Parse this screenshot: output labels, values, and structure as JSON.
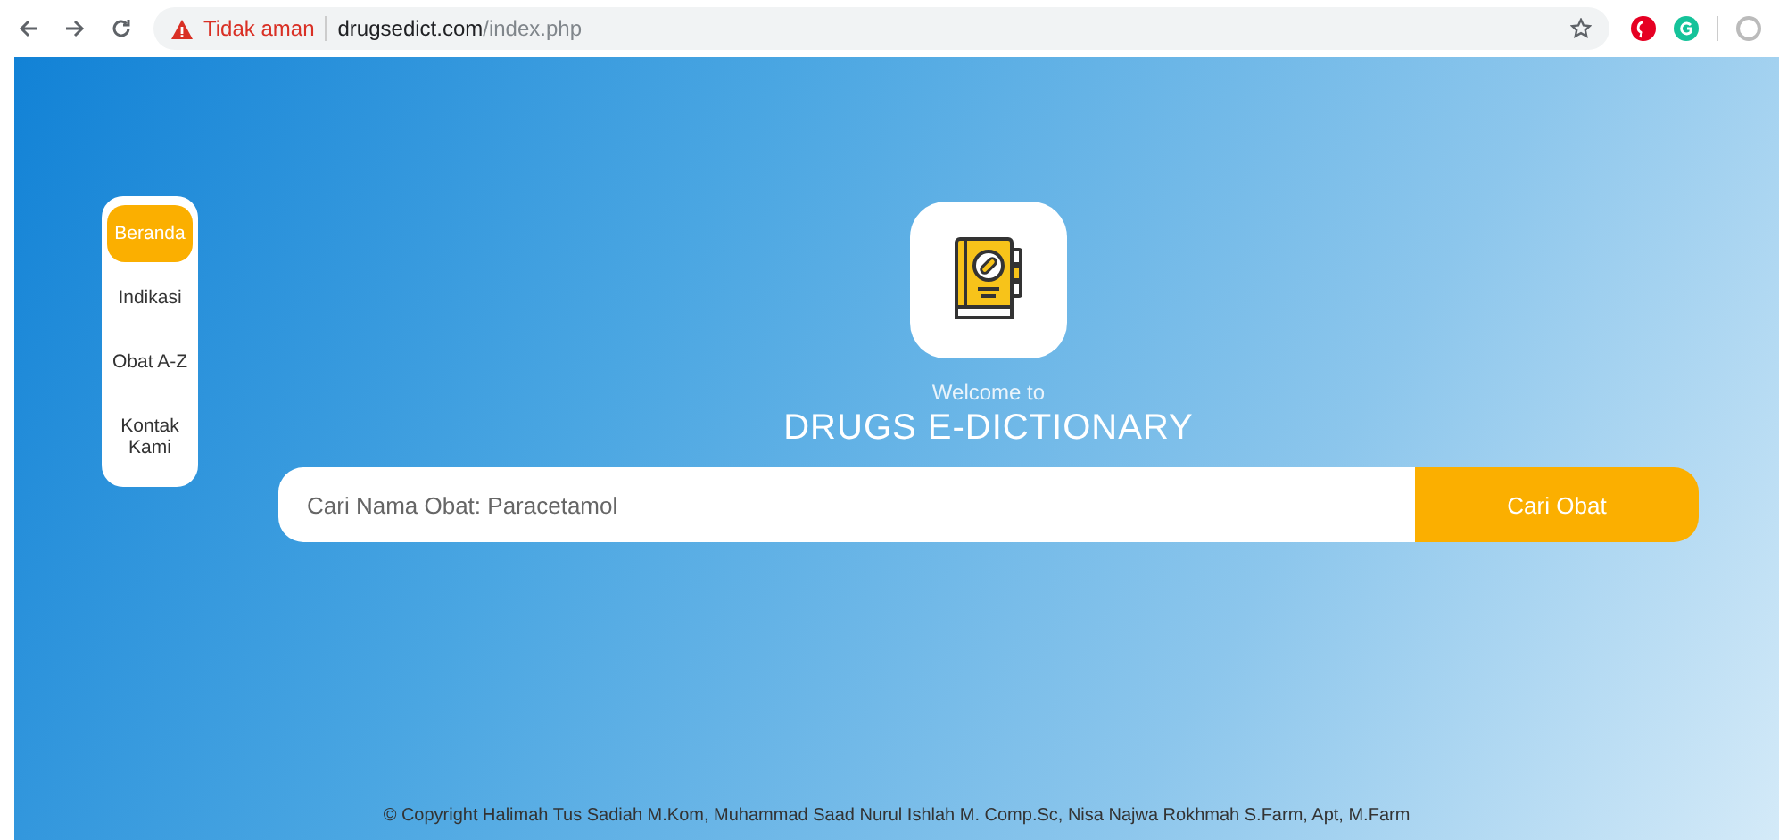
{
  "browser": {
    "security_label": "Tidak aman",
    "url_domain": "drugsedict.com",
    "url_path": "/index.php"
  },
  "sidebar": {
    "items": [
      {
        "label": "Beranda",
        "selected": true
      },
      {
        "label": "Indikasi",
        "selected": false
      },
      {
        "label": "Obat A-Z",
        "selected": false
      },
      {
        "label": "Kontak Kami",
        "selected": false
      }
    ]
  },
  "hero": {
    "welcome": "Welcome to",
    "title": "DRUGS E-DICTIONARY"
  },
  "search": {
    "placeholder": "Cari Nama Obat: Paracetamol",
    "button": "Cari Obat"
  },
  "footer": "© Copyright Halimah Tus Sadiah M.Kom, Muhammad Saad Nurul Ishlah M. Comp.Sc, Nisa Najwa Rokhmah S.Farm, Apt, M.Farm"
}
